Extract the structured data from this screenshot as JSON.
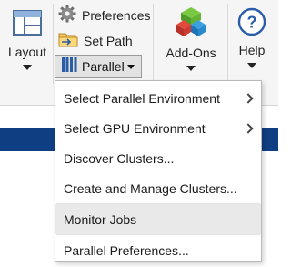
{
  "toolstrip": {
    "layout_label": "Layout",
    "preferences_label": "Preferences",
    "set_path_label": "Set Path",
    "parallel_label": "Parallel",
    "addons_label": "Add-Ons",
    "help_label": "Help",
    "help_glyph": "?"
  },
  "parallel_menu": {
    "items": [
      {
        "label": "Select Parallel Environment"
      },
      {
        "label": "Select GPU Environment"
      },
      {
        "label": "Discover Clusters..."
      },
      {
        "label": "Create and Manage Clusters..."
      },
      {
        "label": "Monitor Jobs"
      },
      {
        "label": "Parallel Preferences..."
      }
    ]
  },
  "colors": {
    "toolstrip_bg": "#f5f5f5",
    "menu_hover": "#e9e9e9",
    "blue_strip": "#0f3f82"
  }
}
